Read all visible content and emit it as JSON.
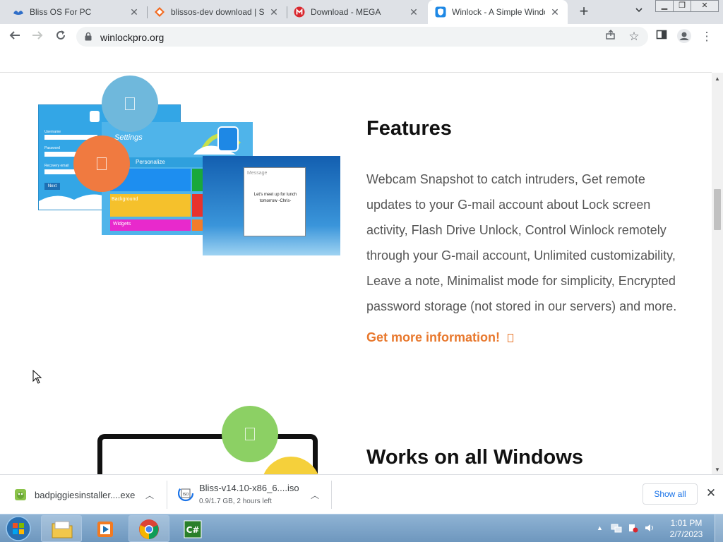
{
  "browser": {
    "tabs": [
      {
        "title": "Bliss OS For PC",
        "icon": "bliss-icon"
      },
      {
        "title": "blissos-dev download | So",
        "icon": "sourceforge-icon"
      },
      {
        "title": "Download - MEGA",
        "icon": "mega-icon"
      },
      {
        "title": "Winlock - A Simple Windo",
        "icon": "winlock-icon",
        "active": true
      }
    ],
    "new_tab": "+",
    "url": "winlockpro.org"
  },
  "page": {
    "features_title": "Features",
    "features_text": "Webcam Snapshot to catch intruders, Get remote updates to your G-mail account about Lock screen activity, Flash Drive Unlock, Control Winlock remotely through your G-mail account, Unlimited customizability, Leave a note, Minimalist mode for simplicity, Encrypted password storage (not stored in our servers) and more.",
    "more_link": "Get more information!",
    "works_title": "Works on all Windows",
    "screenshot": {
      "settings": "Settings",
      "personalize": "Personalize",
      "background": "Background",
      "widgets": "Widgets",
      "message": "Message",
      "note": "Let's meet up for lunch tomorrow -Chris-",
      "next": "Next",
      "username": "Username",
      "password": "Password",
      "recovery": "Recovery email"
    }
  },
  "downloads": {
    "items": [
      {
        "name": "badpiggiesinstaller....exe",
        "status": ""
      },
      {
        "name": "Bliss-v14.10-x86_6....iso",
        "status": "0.9/1.7 GB, 2 hours left"
      }
    ],
    "show_all": "Show all"
  },
  "taskbar": {
    "time": "1:01 PM",
    "date": "2/7/2023"
  },
  "colors": {
    "accent_orange": "#e8782d",
    "circle_blue": "#6fb8dc",
    "circle_orange": "#f07a40",
    "circle_green": "#8cd064",
    "circle_yellow": "#f5d03b"
  }
}
